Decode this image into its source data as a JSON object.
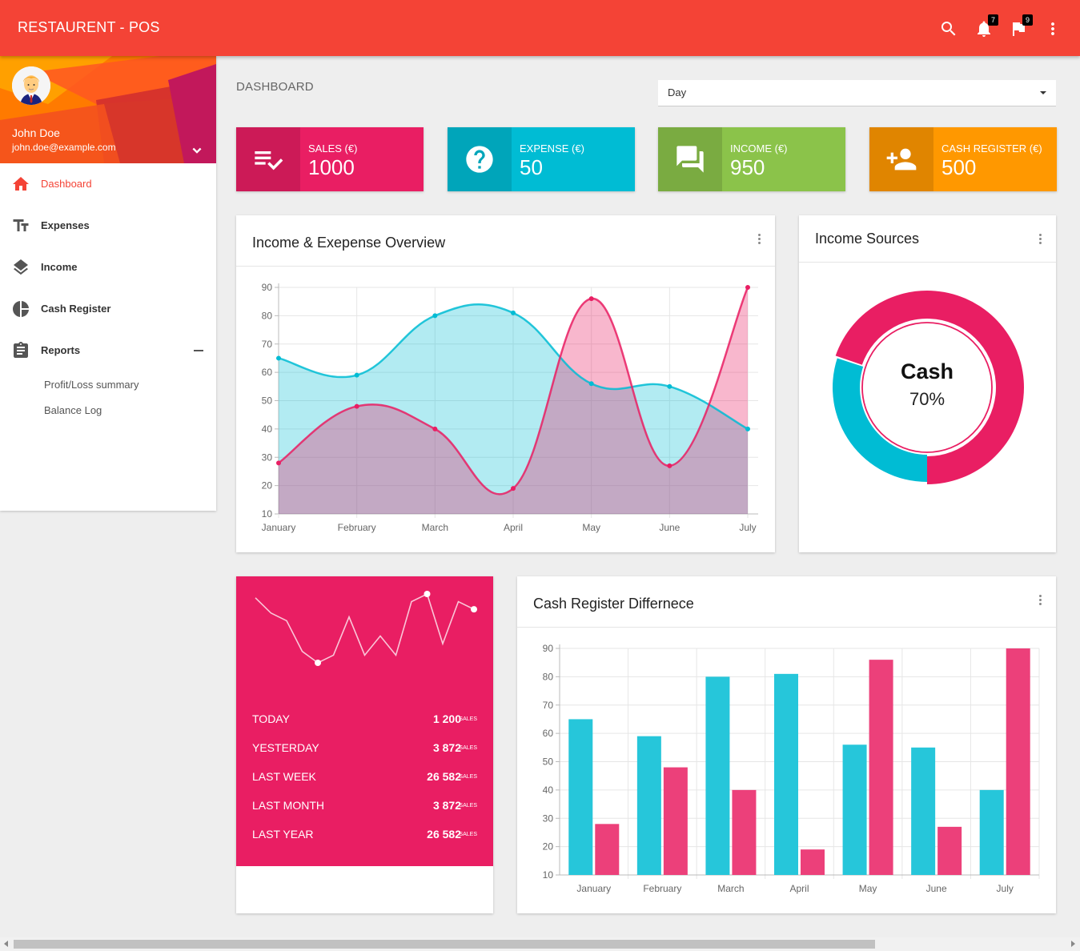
{
  "app": {
    "title": "RESTAURENT - POS"
  },
  "topbar": {
    "icons": [
      "search-icon",
      "bell-icon",
      "flag-icon",
      "more-vert-icon"
    ],
    "notifications_count": "7",
    "flags_count": "9"
  },
  "user": {
    "name": "John Doe",
    "email": "john.doe@example.com"
  },
  "sidebar": {
    "items": [
      {
        "label": "Dashboard",
        "icon": "home-icon",
        "active": true
      },
      {
        "label": "Expenses",
        "icon": "text-fields-icon"
      },
      {
        "label": "Income",
        "icon": "layers-icon"
      },
      {
        "label": "Cash Register",
        "icon": "pie-chart-icon"
      },
      {
        "label": "Reports",
        "icon": "clipboard-icon"
      }
    ],
    "report_subitems": [
      "Profit/Loss summary",
      "Balance Log"
    ]
  },
  "page": {
    "title": "DASHBOARD",
    "period": "Day"
  },
  "stats": [
    {
      "label": "SALES (€)",
      "value": "1000",
      "color": "#e91e63",
      "icon": "playlist-check-icon"
    },
    {
      "label": "EXPENSE (€)",
      "value": "50",
      "color": "#00bcd4",
      "icon": "help-icon"
    },
    {
      "label": "INCOME (€)",
      "value": "950",
      "color": "#8bc34a",
      "icon": "forum-icon"
    },
    {
      "label": "CASH REGISTER (€)",
      "value": "500",
      "color": "#ff9800",
      "icon": "person-add-icon"
    }
  ],
  "overview": {
    "title": "Income & Exepense Overview"
  },
  "sources": {
    "title": "Income Sources",
    "center_label": "Cash",
    "center_value": "70%"
  },
  "sales_summary": {
    "rows": [
      {
        "label": "TODAY",
        "value": "1 200",
        "unit": "SALES"
      },
      {
        "label": "YESTERDAY",
        "value": "3 872",
        "unit": "SALES"
      },
      {
        "label": "LAST WEEK",
        "value": "26 582",
        "unit": "SALES"
      },
      {
        "label": "LAST MONTH",
        "value": "3 872",
        "unit": "SALES"
      },
      {
        "label": "LAST YEAR",
        "value": "26 582",
        "unit": "SALES"
      }
    ]
  },
  "difference": {
    "title": "Cash Register Differnece"
  },
  "chart_data": [
    {
      "type": "area",
      "title": "Income & Exepense Overview",
      "categories": [
        "January",
        "February",
        "March",
        "April",
        "May",
        "June",
        "July"
      ],
      "ylim": [
        10,
        90
      ],
      "yticks": [
        10,
        20,
        30,
        40,
        50,
        60,
        70,
        80,
        90
      ],
      "grid": true,
      "series": [
        {
          "values": [
            65,
            59,
            80,
            81,
            56,
            55,
            40
          ],
          "color": "#00bcd4"
        },
        {
          "values": [
            28,
            48,
            40,
            19,
            86,
            27,
            90
          ],
          "color": "#e91e63"
        }
      ]
    },
    {
      "type": "pie",
      "title": "Income Sources",
      "values": [
        70,
        30
      ],
      "labels": [
        "Cash",
        ""
      ],
      "colors": [
        "#e91e63",
        "#00bcd4"
      ]
    },
    {
      "type": "line",
      "values": [
        28,
        24,
        22,
        14,
        11,
        13,
        23,
        13,
        18,
        13,
        27,
        29,
        16,
        27,
        25
      ],
      "highlighted_indices": [
        4,
        11,
        14
      ],
      "color": "#ffffff"
    },
    {
      "type": "bar",
      "title": "Cash Register Differnece",
      "categories": [
        "January",
        "February",
        "March",
        "April",
        "May",
        "June",
        "July"
      ],
      "ylim": [
        10,
        90
      ],
      "yticks": [
        10,
        20,
        30,
        40,
        50,
        60,
        70,
        80,
        90
      ],
      "grid": true,
      "series": [
        {
          "values": [
            65,
            59,
            80,
            81,
            56,
            55,
            40
          ],
          "color": "#26c6da"
        },
        {
          "values": [
            28,
            48,
            40,
            19,
            86,
            27,
            90
          ],
          "color": "#ec407a"
        }
      ]
    }
  ]
}
